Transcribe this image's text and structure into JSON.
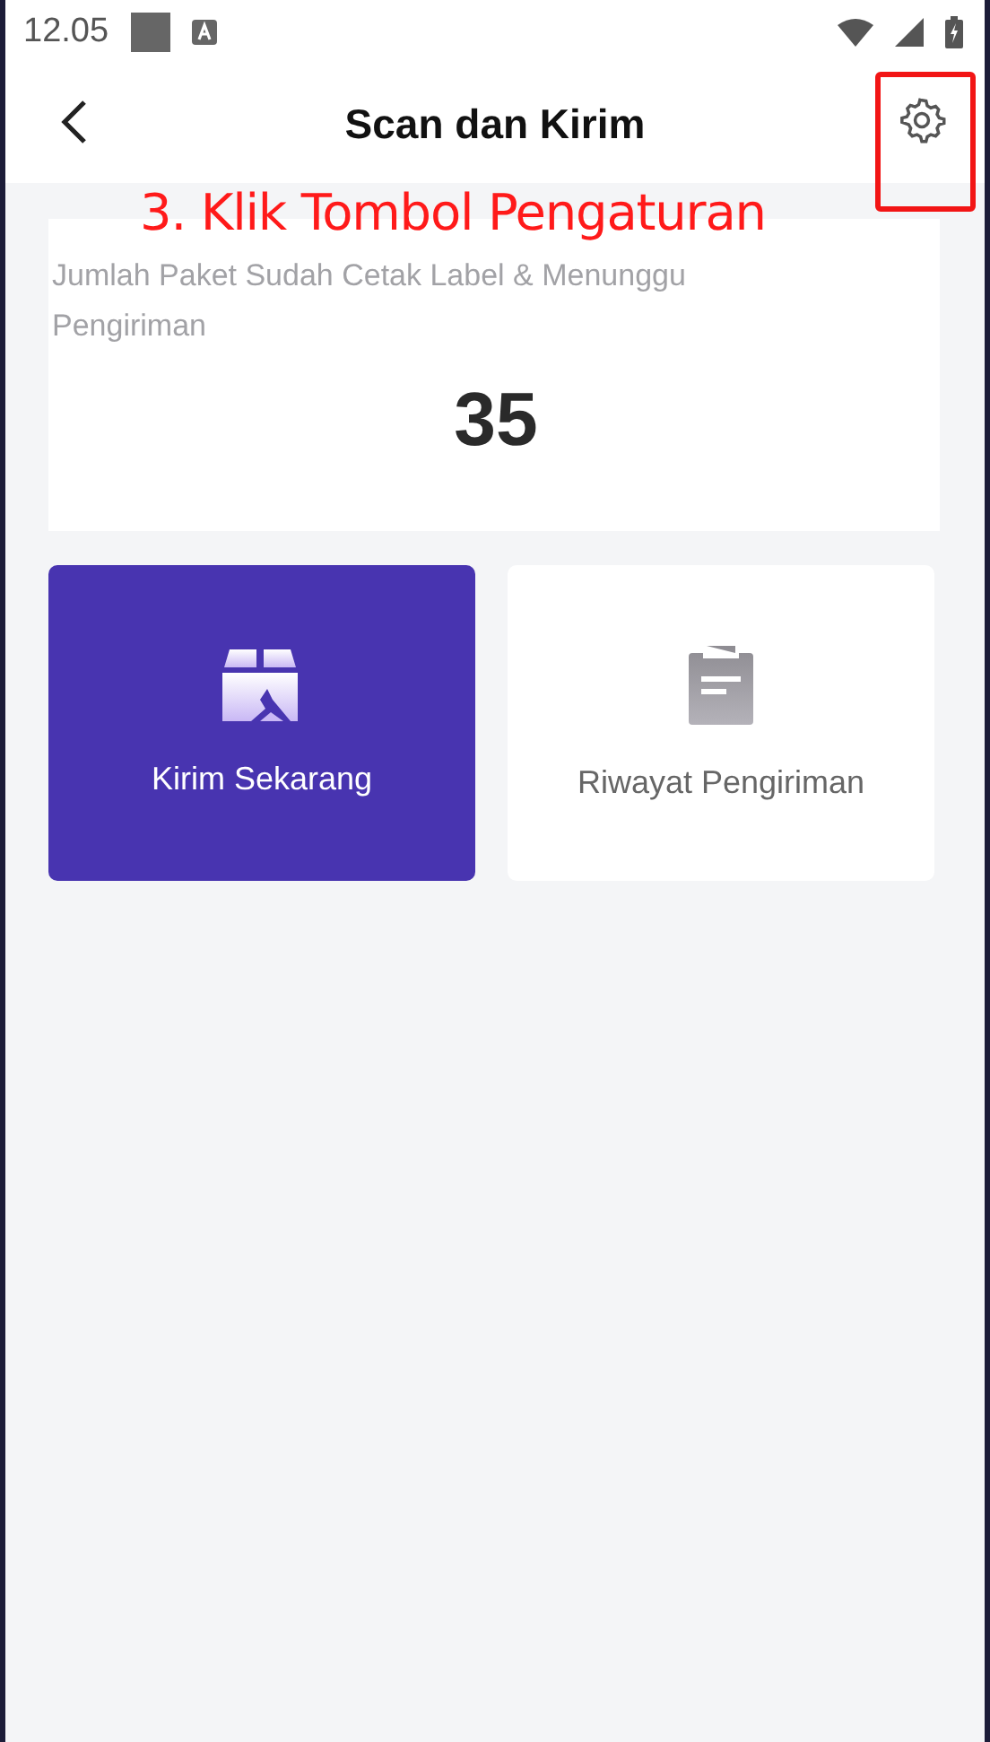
{
  "status_bar": {
    "time": "12.05"
  },
  "header": {
    "title": "Scan dan Kirim"
  },
  "annotation": {
    "text": "3. Klik Tombol Pengaturan"
  },
  "summary": {
    "label": "Jumlah Paket Sudah Cetak Label & Menunggu Pengiriman",
    "count": "35"
  },
  "actions": [
    {
      "kind": "send",
      "label": "Kirim Sekarang",
      "selected": true
    },
    {
      "kind": "history",
      "label": "Riwayat Pengiriman",
      "selected": false
    }
  ]
}
